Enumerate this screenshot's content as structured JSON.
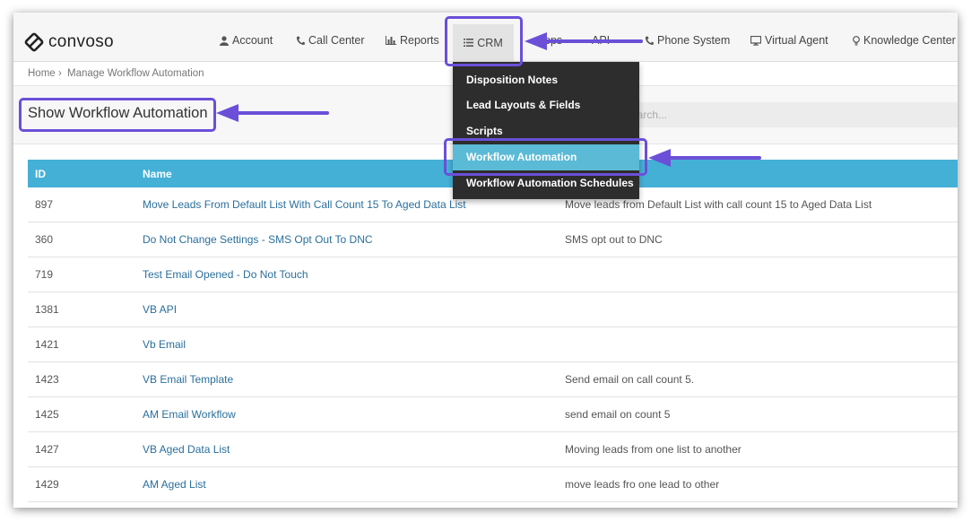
{
  "brand": {
    "name": "convoso",
    "logo_icon": "convoso-logo-icon"
  },
  "nav": {
    "account": "Account",
    "call_center": "Call Center",
    "reports": "Reports",
    "crm": "CRM",
    "apps_fragment": "pps",
    "api_fragment": "API",
    "phone_system": "Phone System",
    "virtual_agent": "Virtual Agent",
    "knowledge_center": "Knowledge Center"
  },
  "breadcrumb": {
    "home": "Home",
    "separator": "›",
    "current": "Manage Workflow Automation"
  },
  "page": {
    "title": "Show Workflow Automation",
    "search_placeholder": "earch..."
  },
  "crm_menu": {
    "items": [
      {
        "label": "Disposition Notes"
      },
      {
        "label": "Lead Layouts & Fields"
      },
      {
        "label": "Scripts"
      },
      {
        "label": "Workflow Automation"
      },
      {
        "label": "Workflow Automation Schedules"
      }
    ],
    "active_index": 3
  },
  "table": {
    "headers": {
      "id": "ID",
      "name": "Name"
    },
    "rows": [
      {
        "id": "897",
        "name": "Move Leads From Default List With Call Count 15 To Aged Data List",
        "description": "Move leads from Default List with call count 15 to Aged Data List"
      },
      {
        "id": "360",
        "name": "Do Not Change Settings - SMS Opt Out To DNC",
        "description": "SMS opt out to DNC"
      },
      {
        "id": "719",
        "name": "Test Email Opened - Do Not Touch",
        "description": ""
      },
      {
        "id": "1381",
        "name": "VB API",
        "description": ""
      },
      {
        "id": "1421",
        "name": "Vb Email",
        "description": ""
      },
      {
        "id": "1423",
        "name": "VB Email Template",
        "description": "Send email on call count 5."
      },
      {
        "id": "1425",
        "name": "AM Email Workflow",
        "description": "send email on count 5"
      },
      {
        "id": "1427",
        "name": "VB Aged Data List",
        "description": "Moving leads from one list to another"
      },
      {
        "id": "1429",
        "name": "AM Aged List",
        "description": "move leads fro one lead to other"
      }
    ]
  },
  "colors": {
    "accent": "#45b0d6",
    "annotation": "#6b4fd8",
    "menu_bg": "#2d2d2d",
    "menu_active": "#5bbad5",
    "link": "#2a6f9c"
  }
}
